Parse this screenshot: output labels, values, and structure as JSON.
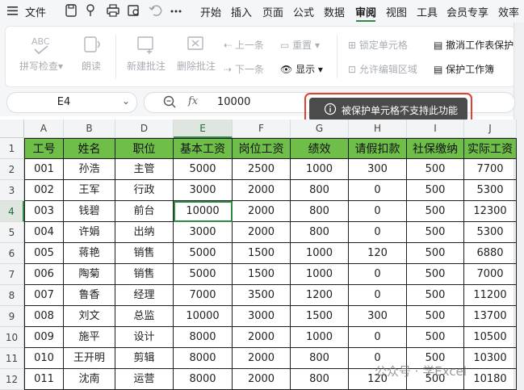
{
  "menubar": {
    "file_label": "文件",
    "tabs": [
      "开始",
      "插入",
      "页面",
      "公式",
      "数据",
      "审阅",
      "视图",
      "工具",
      "会员专享",
      "效率"
    ],
    "active_tab": "审阅"
  },
  "ribbon": {
    "spell_check": "拼写检查",
    "read_aloud": "朗读",
    "new_comment": "新建批注",
    "delete_comment": "删除批注",
    "prev_comment": "上一条",
    "next_comment": "下一条",
    "reset": "重置",
    "show": "显示",
    "lock_cell": "锁定单元格",
    "allow_edit_range": "允许编辑区域",
    "unprotect_sheet": "撤消工作表保护",
    "protect_workbook": "保护工作簿"
  },
  "formula_bar": {
    "name_box": "E4",
    "fx_symbol": "fx",
    "formula": "10000"
  },
  "tooltip": {
    "text": "被保护单元格不支持此功能"
  },
  "sheet": {
    "columns": [
      "A",
      "B",
      "D",
      "E",
      "F",
      "G",
      "H",
      "I",
      "J"
    ],
    "selected_column": "E",
    "row_numbers": [
      "1",
      "2",
      "3",
      "4",
      "5",
      "6",
      "7",
      "8",
      "9",
      "10",
      "11",
      "12"
    ],
    "selected_row": "4",
    "header": [
      "工号",
      "姓名",
      "职位",
      "基本工资",
      "岗位工资",
      "绩效",
      "请假扣款",
      "社保缴纳",
      "实际工资"
    ],
    "rows": [
      [
        "001",
        "孙浩",
        "主管",
        "5000",
        "2500",
        "1000",
        "300",
        "500",
        "7700"
      ],
      [
        "002",
        "王军",
        "行政",
        "3000",
        "2000",
        "800",
        "0",
        "500",
        "5300"
      ],
      [
        "003",
        "钱碧",
        "前台",
        "10000",
        "2000",
        "800",
        "0",
        "500",
        "12300"
      ],
      [
        "004",
        "许娟",
        "出纳",
        "3000",
        "2000",
        "800",
        "0",
        "500",
        "5300"
      ],
      [
        "005",
        "蒋艳",
        "销售",
        "5000",
        "1500",
        "1000",
        "120",
        "500",
        "6880"
      ],
      [
        "006",
        "陶菊",
        "销售",
        "5000",
        "1500",
        "1000",
        "0",
        "500",
        "7000"
      ],
      [
        "007",
        "鲁香",
        "经理",
        "7000",
        "3500",
        "1200",
        "0",
        "500",
        "11200"
      ],
      [
        "008",
        "刘文",
        "总监",
        "10000",
        "3000",
        "1500",
        "300",
        "500",
        "13700"
      ],
      [
        "009",
        "施平",
        "设计",
        "8000",
        "2000",
        "1000",
        "0",
        "500",
        "10500"
      ],
      [
        "010",
        "王开明",
        "剪辑",
        "8000",
        "2000",
        "800",
        "0",
        "500",
        "10300"
      ],
      [
        "011",
        "沈南",
        "运营",
        "8000",
        "2000",
        "800",
        "120",
        "500",
        "10180"
      ]
    ],
    "selected_cell": "E4"
  },
  "watermark": "公众号 · 学Excel",
  "colors": {
    "accent": "#2f8a45",
    "header_fill": "#6fbe4a",
    "tooltip_bg": "#4b4b4b",
    "highlight_border": "#e0412e"
  }
}
